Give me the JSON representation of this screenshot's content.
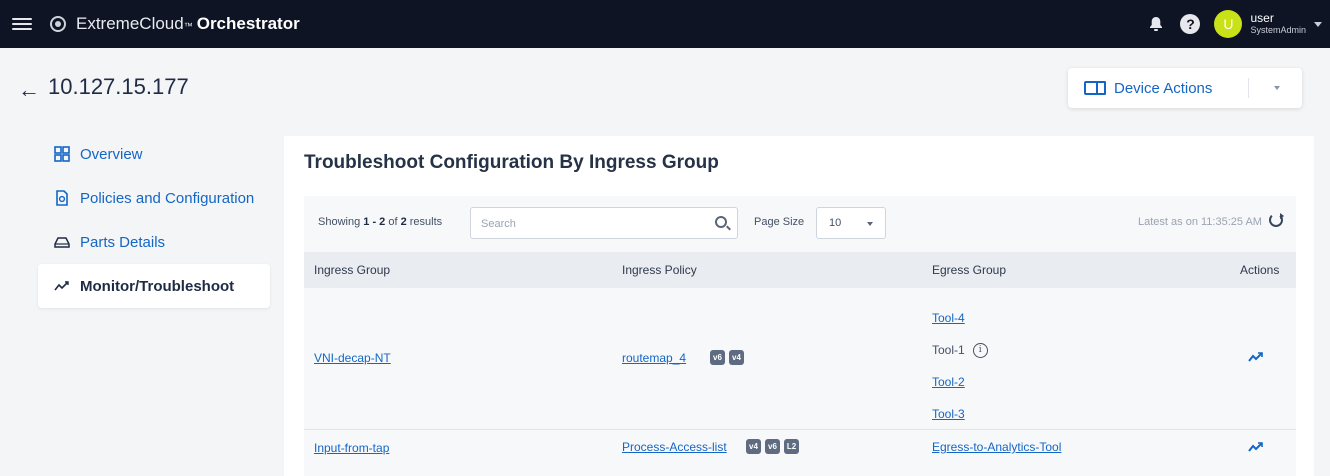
{
  "topbar": {
    "app_name_prefix": "ExtremeCloud",
    "trademark": "™",
    "app_name_bold": "Orchestrator",
    "user_initial": "U",
    "user_name": "user",
    "user_role": "SystemAdmin",
    "help_glyph": "?"
  },
  "header": {
    "back_glyph": "←",
    "device_ip": "10.127.15.177",
    "device_actions_label": "Device Actions"
  },
  "sidebar": {
    "items": [
      {
        "label": "Overview",
        "icon": "grid-icon"
      },
      {
        "label": "Policies and Configuration",
        "icon": "document-gear-icon"
      },
      {
        "label": "Parts Details",
        "icon": "parts-icon"
      },
      {
        "label": "Monitor/Troubleshoot",
        "icon": "trend-icon",
        "active": true
      }
    ]
  },
  "main": {
    "title": "Troubleshoot Configuration By Ingress Group",
    "showing_prefix": "Showing ",
    "showing_range": "1 - 2",
    "showing_of": " of ",
    "showing_total": "2",
    "showing_suffix": " results",
    "search_placeholder": "Search",
    "page_size_label": "Page Size",
    "page_size_value": "10",
    "latest_as_on": "Latest as on 11:35:25 AM",
    "columns": [
      "Ingress Group",
      "Ingress Policy",
      "Egress Group",
      "Actions"
    ],
    "rows": [
      {
        "ingress_group": "VNI-decap-NT",
        "ingress_policy": "routemap_4",
        "badges": [
          "v6",
          "v4"
        ],
        "egress": [
          {
            "label": "Tool-4",
            "link": true
          },
          {
            "label": "Tool-1",
            "link": false,
            "info": "i"
          },
          {
            "label": "Tool-2",
            "link": true
          },
          {
            "label": "Tool-3",
            "link": true
          }
        ]
      },
      {
        "ingress_group": "Input-from-tap",
        "ingress_policy": "Process-Access-list",
        "badges": [
          "v4",
          "v6",
          "L2"
        ],
        "egress": [
          {
            "label": "Egress-to-Analytics-Tool",
            "link": true
          }
        ]
      }
    ]
  },
  "colors": {
    "topbar_bg": "#0e1424",
    "accent": "#1466c6",
    "avatar": "#c8e217",
    "badge": "#5e6b80"
  }
}
